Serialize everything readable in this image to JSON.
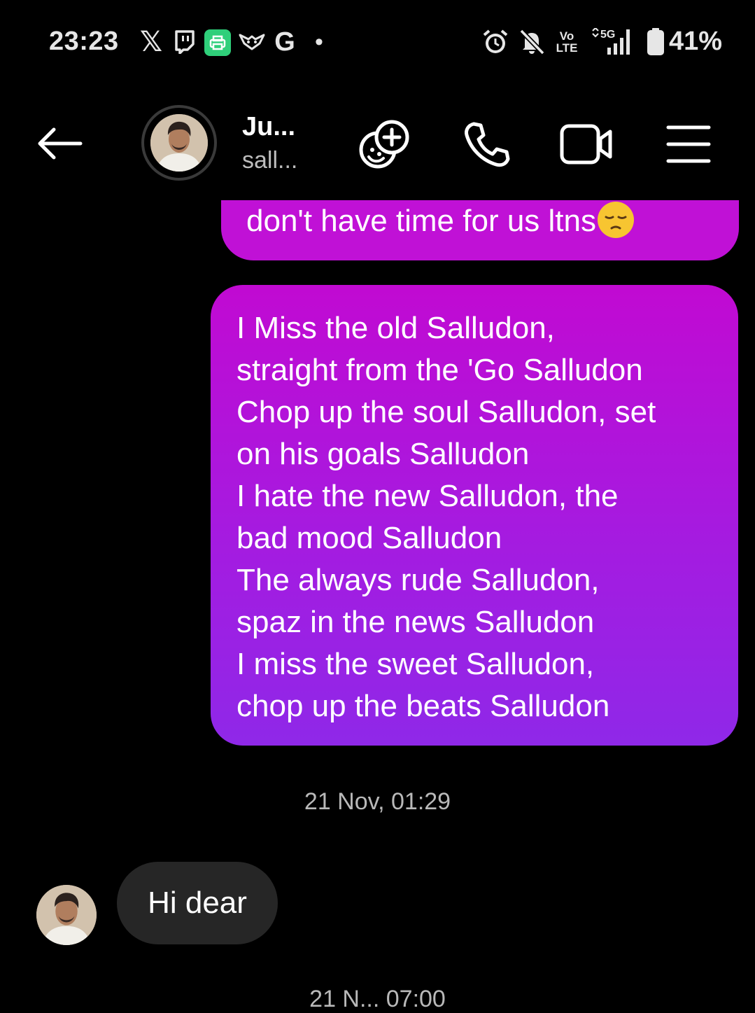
{
  "status_bar": {
    "time": "23:23",
    "left_icons": [
      "x-icon",
      "twitch-icon",
      "printer-app-icon",
      "fox-app-icon",
      "google-icon",
      "dot-icon"
    ],
    "x_glyph": "𝕏",
    "google_glyph": "G",
    "dot_glyph": "•",
    "right_icons": [
      "alarm-icon",
      "mute-icon",
      "volte-icon",
      "signal-5g-icon",
      "battery-icon"
    ],
    "volte_top": "Vo",
    "volte_bottom": "LTE",
    "network": "5G",
    "battery_percent": "41%"
  },
  "header": {
    "contact_name": "Ju...",
    "contact_username": "sall...",
    "actions": [
      "effects-icon",
      "phone-call-icon",
      "video-call-icon",
      "menu-icon"
    ]
  },
  "messages": {
    "sent_partial": {
      "text": "don't have time for us ltns",
      "emoji": "pensive-face-emoji"
    },
    "sent_main": {
      "lines": [
        "I Miss the old Salludon,",
        "straight from the 'Go Salludon",
        "Chop up the soul Salludon, set",
        "on his goals Salludon",
        "I hate the new Salludon, the",
        "bad mood Salludon",
        "The always rude Salludon,",
        "spaz in the news Salludon",
        "I miss the sweet Salludon,",
        "chop up the beats Salludon"
      ]
    },
    "timestamp": "21 Nov, 01:29",
    "received": {
      "text": "Hi dear"
    },
    "next_timestamp_partial": "21 N... 07:00"
  },
  "colors": {
    "background": "#000000",
    "sent_bubble_top": "#c10ad2",
    "sent_bubble_bottom": "#8f28e8",
    "received_bubble": "#262626",
    "timestamp_text": "#b9b9b9"
  }
}
